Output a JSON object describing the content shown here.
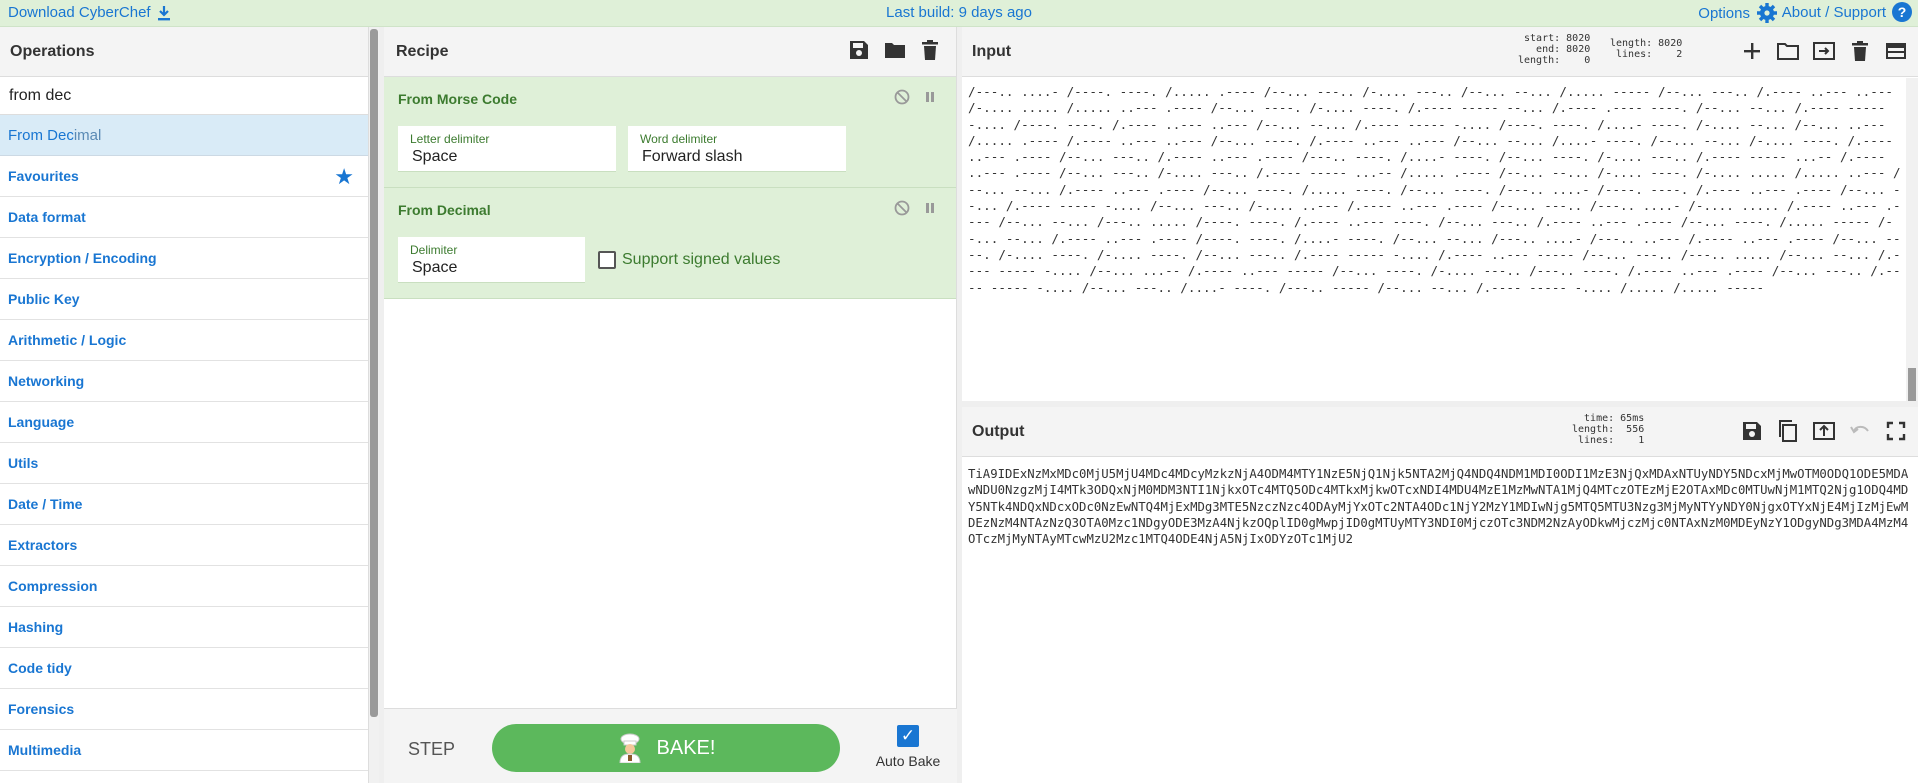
{
  "banner": {
    "download_label": "Download CyberChef",
    "last_build": "Last build: 9 days ago",
    "options_label": "Options",
    "about_label": "About / Support",
    "help_glyph": "?"
  },
  "operations": {
    "title": "Operations",
    "search_value": "from dec",
    "result": {
      "match": "From Dec",
      "rest": "imal"
    },
    "categories": [
      "Favourites",
      "Data format",
      "Encryption / Encoding",
      "Public Key",
      "Arithmetic / Logic",
      "Networking",
      "Language",
      "Utils",
      "Date / Time",
      "Extractors",
      "Compression",
      "Hashing",
      "Code tidy",
      "Forensics",
      "Multimedia"
    ]
  },
  "recipe": {
    "title": "Recipe",
    "ops": [
      {
        "name": "From Morse Code",
        "fields": [
          {
            "label": "Letter delimiter",
            "value": "Space"
          },
          {
            "label": "Word delimiter",
            "value": "Forward slash"
          }
        ]
      },
      {
        "name": "From Decimal",
        "fields": [
          {
            "label": "Delimiter",
            "value": "Space"
          }
        ],
        "checkbox_label": "Support signed values"
      }
    ],
    "step_label": "STEP",
    "bake_label": "BAKE!",
    "auto_bake_label": "Auto Bake",
    "auto_bake_glyph": "✓"
  },
  "input": {
    "title": "Input",
    "stats_left": "start: 8020\n  end: 8020\nlength:    0",
    "stats_right": "length: 8020\n lines:    2",
    "text": "/---.. ....- /----. ----. /..... .---- /--... ---.. /-.... ---.. /--... --... /..... ----- /--... ---.. /.---- ..--- ..--- /-.... ..... /..... ..--- .---- /--... ----. /-.... ----. /.---- ----- --... /.---- .---- ----. /--... --... /.---- ----- -.... /----. ----. /.---- ..--- ..--- /--... --... /.---- ----- -.... /----. ----. /....- ----. /-.... --... /--... ..--- /..... .---- /.---- ..--- ..--- /--... ----. /.---- ..--- ..--- /--... --... /....- ----. /--... --... /-.... ----. /.---- ..--- .---- /--... ---.. /.---- ..--- .---- /---.. ----. /....- ----. /--... ----. /-.... ---.. /.---- ----- ...-- /.---- ..--- .---- /--... ---.. /-.... ---.. /.---- ----- ...-- /..... .---- /--... --... /-.... ----. /-.... ..... /..... ..--- /--... --... /.---- ..--- .---- /--... ----. /..... ----. /--... ----. /---.. ....- /----. ----. /.---- ..--- .---- /--... --... /.---- ----- -.... /--... ---.. /-.... ..--- /.---- ..--- .---- /--... ---.. /---.. ....- /-.... ..... /.---- ..--- .---- /--... --... /---.. ..... /----. ----. /.---- ..--- ----. /--... ---.. /.---- ..--- .---- /--... ----. /..... ----- /--... --... /.---- ..--- .---- /----. ----. /....- ----. /--... --... /---.. ....- /---.. ..--- /.---- ..--- .---- /--... ----. /-.... ----. /-.... ----. /--... ---.. /.---- ----- -.... /.---- ..--- ----- /--... ---.. /---.. ..... /--... --... /.---- ----- -.... /--... ...-- /.---- ..--- ----- /--... ----. /-.... ---.. /---.. ----. /.---- ..--- .---- /--... ---.. /.---- ----- -.... /--... ---.. /....- ----. /---.. ----- /--... --... /.---- ----- -.... /..... /..... -----"
  },
  "output": {
    "title": "Output",
    "stats": "time: 65ms\nlength:  556\nlines:    1",
    "text": "TiA9IDExNzMxMDc0MjU5MjU4MDc4MDcyMzkzNjA4ODM4MTY1NzE5NjQ1Njk5NTA2MjQ4NDQ4NDM1MDI0ODI1MzE3NjQxMDAxNTUyNDY5NDcxMjMwOTM0ODQ1ODE5MDAwNDU0NzgzMjI4MTk3ODQxNjM0MDM3NTI1NjkxOTc4MTQ5ODc4MTkxMjkwOTcxNDI4MDU4MzE1MzMwNTA1MjQ4MTczOTEzMjE2OTAxMDc0MTUwNjM1MTQ2Njg1ODQ4MDY5NTk4NDQxNDcxODc0NzEwNTQ4MjExMDg3MTE5NzczNzc4ODAyMjYxOTc2NTA4ODc1NjY2MzY1MDIwNjg5MTQ5MTU3Nzg3MjMyNTYyNDY0NjgxOTYxNjE4MjIzMjEwMDEzNzM4NTAzNzQ3OTA0Mzc1NDgyODE3MzA4NjkzOQplID0gMwpjID0gMTUyMTY3NDI0MjczOTc3NDM2NzAyODkwMjczMjc0NTAxNzM0MDEyNzY1ODgyNDg3MDA4MzM4OTczMjMyNTAyMTcwMzU2Mzc1MTQ4ODE4NjA5NjIxODYzOTc1MjU2"
  }
}
